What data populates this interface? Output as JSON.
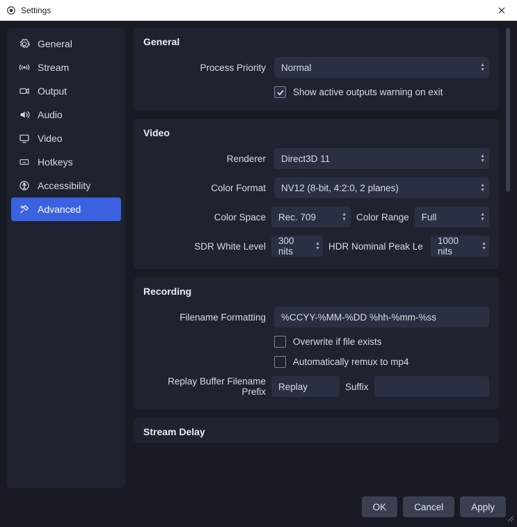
{
  "window": {
    "title": "Settings"
  },
  "sidebar": {
    "items": [
      {
        "label": "General"
      },
      {
        "label": "Stream"
      },
      {
        "label": "Output"
      },
      {
        "label": "Audio"
      },
      {
        "label": "Video"
      },
      {
        "label": "Hotkeys"
      },
      {
        "label": "Accessibility"
      },
      {
        "label": "Advanced"
      }
    ]
  },
  "sections": {
    "general": {
      "title": "General",
      "process_priority_label": "Process Priority",
      "process_priority_value": "Normal",
      "show_active_outputs_label": "Show active outputs warning on exit",
      "show_active_outputs_checked": true
    },
    "video": {
      "title": "Video",
      "renderer_label": "Renderer",
      "renderer_value": "Direct3D 11",
      "color_format_label": "Color Format",
      "color_format_value": "NV12 (8-bit, 4:2:0, 2 planes)",
      "color_space_label": "Color Space",
      "color_space_value": "Rec. 709",
      "color_range_label": "Color Range",
      "color_range_value": "Full",
      "sdr_white_label": "SDR White Level",
      "sdr_white_value": "300 nits",
      "hdr_peak_label": "HDR Nominal Peak Le",
      "hdr_peak_value": "1000 nits"
    },
    "recording": {
      "title": "Recording",
      "filename_formatting_label": "Filename Formatting",
      "filename_formatting_value": "%CCYY-%MM-%DD %hh-%mm-%ss",
      "overwrite_label": "Overwrite if file exists",
      "overwrite_checked": false,
      "remux_label": "Automatically remux to mp4",
      "remux_checked": false,
      "replay_prefix_label": "Replay Buffer Filename Prefix",
      "replay_prefix_value": "Replay",
      "replay_suffix_label": "Suffix",
      "replay_suffix_value": ""
    },
    "stream_delay": {
      "title": "Stream Delay"
    }
  },
  "footer": {
    "ok": "OK",
    "cancel": "Cancel",
    "apply": "Apply"
  }
}
